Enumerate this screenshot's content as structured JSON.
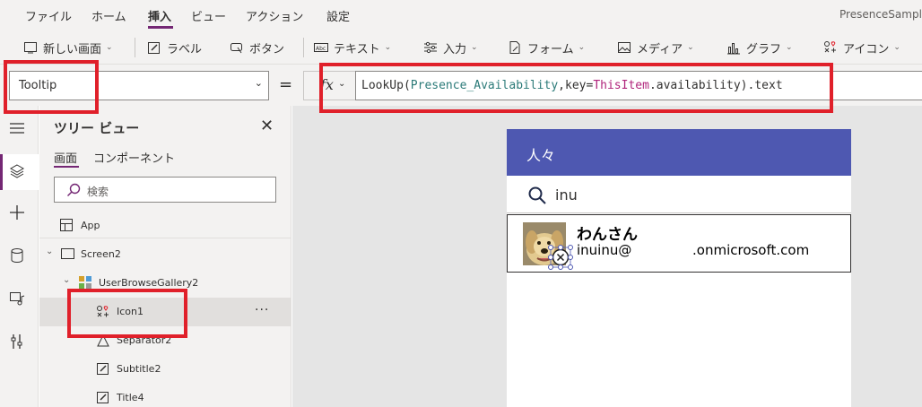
{
  "menu": {
    "items": [
      "ファイル",
      "ホーム",
      "挿入",
      "ビュー",
      "アクション",
      "設定"
    ],
    "active": "挿入",
    "app_name": "PresenceSampl"
  },
  "toolbar": {
    "new_screen": "新しい画面",
    "label": "ラベル",
    "button": "ボタン",
    "text": "テキスト",
    "input": "入力",
    "form": "フォーム",
    "media": "メディア",
    "chart": "グラフ",
    "icon": "アイコン"
  },
  "formula_bar": {
    "property": "Tooltip",
    "equals": "=",
    "fx": "fx",
    "formula": {
      "fn": "LookUp(",
      "source": "Presence_Availability",
      "mid": ",key=",
      "this_item": "ThisItem",
      "tail": ".availability).text"
    }
  },
  "tree_view": {
    "title": "ツリー ビュー",
    "tabs": [
      "画面",
      "コンポーネント"
    ],
    "search_placeholder": "検索",
    "app": "App",
    "nodes": [
      "Screen2",
      "UserBrowseGallery2",
      "Icon1",
      "Separator2",
      "Subtitle2",
      "Title4"
    ],
    "selected": "Icon1",
    "more": "···"
  },
  "app_screen": {
    "header_title": "人々",
    "search_value": "inu",
    "user": {
      "name": "わんさん",
      "email_prefix": "inuinu@",
      "email_domain": ".onmicrosoft.com"
    }
  },
  "colors": {
    "accent": "#742774",
    "header": "#4e58b1",
    "highlight": "#e0202a"
  }
}
